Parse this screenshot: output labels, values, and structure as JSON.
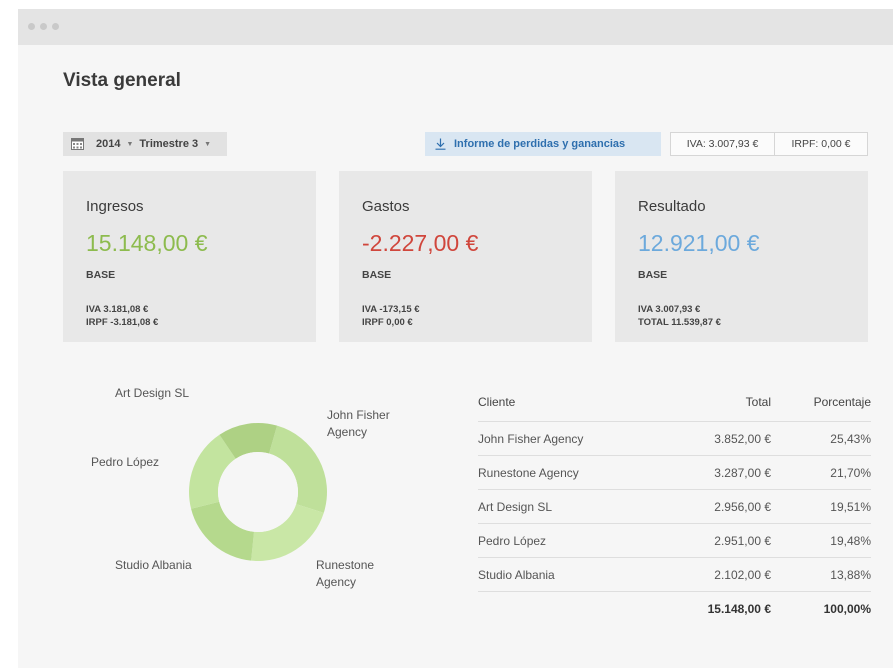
{
  "page": {
    "title": "Vista general"
  },
  "toolbar": {
    "year": "2014",
    "quarter": "Trimestre 3",
    "report_button": "Informe de perdidas y ganancias",
    "iva": "IVA: 3.007,93 €",
    "irpf": "IRPF: 0,00 €"
  },
  "cards": [
    {
      "title": "Ingresos",
      "amount": "15.148,00 €",
      "base": "BASE",
      "line1": "IVA 3.181,08 €",
      "line2": "IRPF -3.181,08 €",
      "color": "#8dbb4e"
    },
    {
      "title": "Gastos",
      "amount": "-2.227,00 €",
      "base": "BASE",
      "line1": "IVA -173,15 €",
      "line2": "IRPF 0,00 €",
      "color": "#d0463c"
    },
    {
      "title": "Resultado",
      "amount": "12.921,00 €",
      "base": "BASE",
      "line1": "IVA 3.007,93 €",
      "line2": "TOTAL 11.539,87 €",
      "color": "#6ca9dc"
    }
  ],
  "chart_data": {
    "type": "pie",
    "categories": [
      "John Fisher Agency",
      "Runestone Agency",
      "Art Design SL",
      "Pedro López",
      "Studio Albania"
    ],
    "values": [
      25.43,
      21.7,
      19.51,
      19.48,
      13.88
    ],
    "labels": {
      "john": [
        "John Fisher",
        "Agency"
      ],
      "runestone": [
        "Runestone",
        "Agency"
      ],
      "art": "Art Design SL",
      "pedro": "Pedro López",
      "albania": "Studio Albania"
    },
    "colors": [
      "#bfe09a",
      "#c9e7a6",
      "#b5d98d",
      "#c3e49f",
      "#aed184"
    ]
  },
  "table": {
    "headers": [
      "Cliente",
      "Total",
      "Porcentaje"
    ],
    "rows": [
      [
        "John Fisher Agency",
        "3.852,00 €",
        "25,43%"
      ],
      [
        "Runestone Agency",
        "3.287,00 €",
        "21,70%"
      ],
      [
        "Art Design SL",
        "2.956,00 €",
        "19,51%"
      ],
      [
        "Pedro López",
        "2.951,00 €",
        "19,48%"
      ],
      [
        "Studio Albania",
        "2.102,00 €",
        "13,88%"
      ]
    ],
    "total": [
      "",
      "15.148,00 €",
      "100,00%"
    ]
  }
}
